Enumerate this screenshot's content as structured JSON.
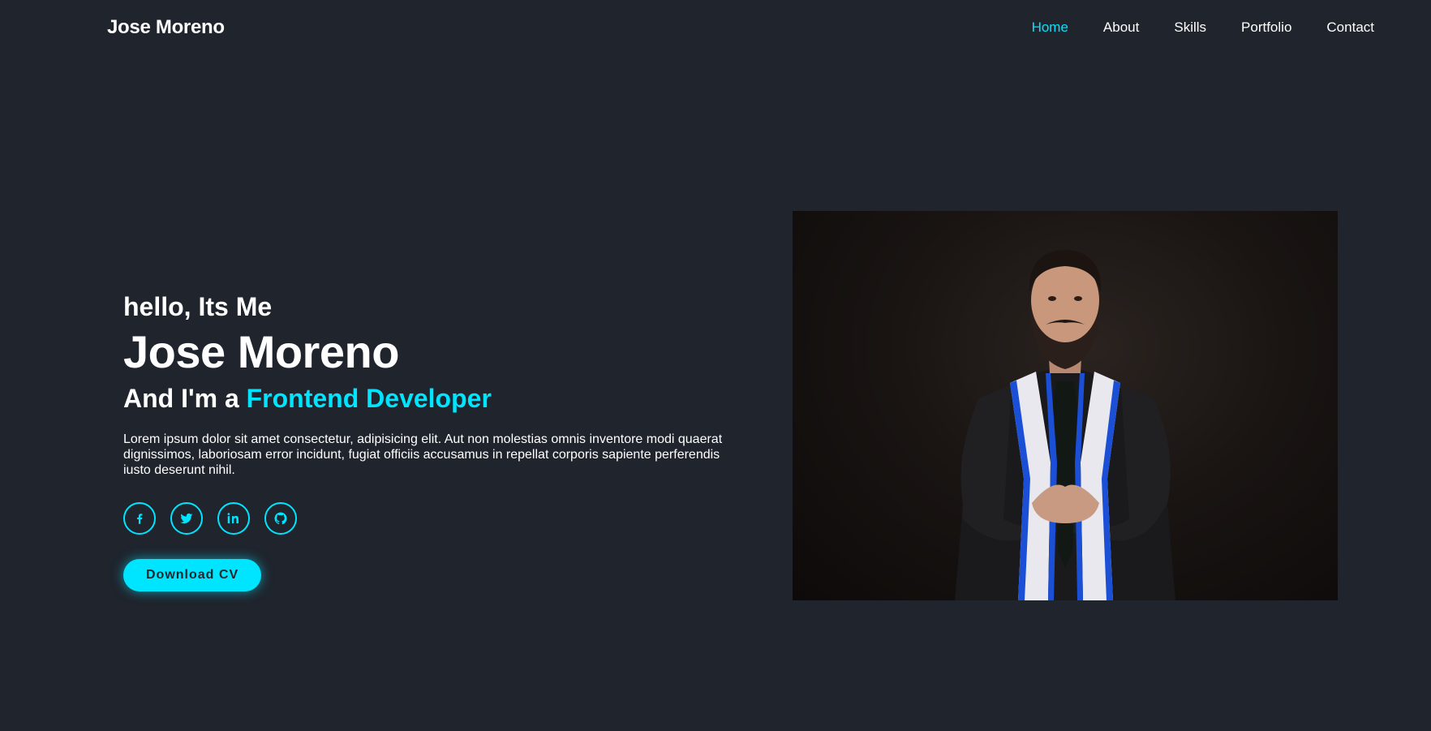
{
  "header": {
    "logo": "Jose Moreno",
    "nav": [
      {
        "label": "Home",
        "active": true
      },
      {
        "label": "About",
        "active": false
      },
      {
        "label": "Skills",
        "active": false
      },
      {
        "label": "Portfolio",
        "active": false
      },
      {
        "label": "Contact",
        "active": false
      }
    ]
  },
  "hero": {
    "greeting": "hello, Its Me",
    "name": "Jose Moreno",
    "role_prefix": "And I'm a ",
    "role_accent": "Frontend Developer",
    "description": "Lorem ipsum dolor sit amet consectetur, adipisicing elit. Aut non molestias omnis inventore modi quaerat dignissimos, laboriosam error incidunt, fugiat officiis accusamus in repellat corporis sapiente perferendis iusto deserunt nihil.",
    "socials": [
      {
        "icon": "facebook-icon"
      },
      {
        "icon": "twitter-icon"
      },
      {
        "icon": "linkedin-icon"
      },
      {
        "icon": "github-icon"
      }
    ],
    "cta_label": "Download CV"
  },
  "colors": {
    "background": "#1f242d",
    "accent": "#00e5ff",
    "text": "#ffffff"
  }
}
